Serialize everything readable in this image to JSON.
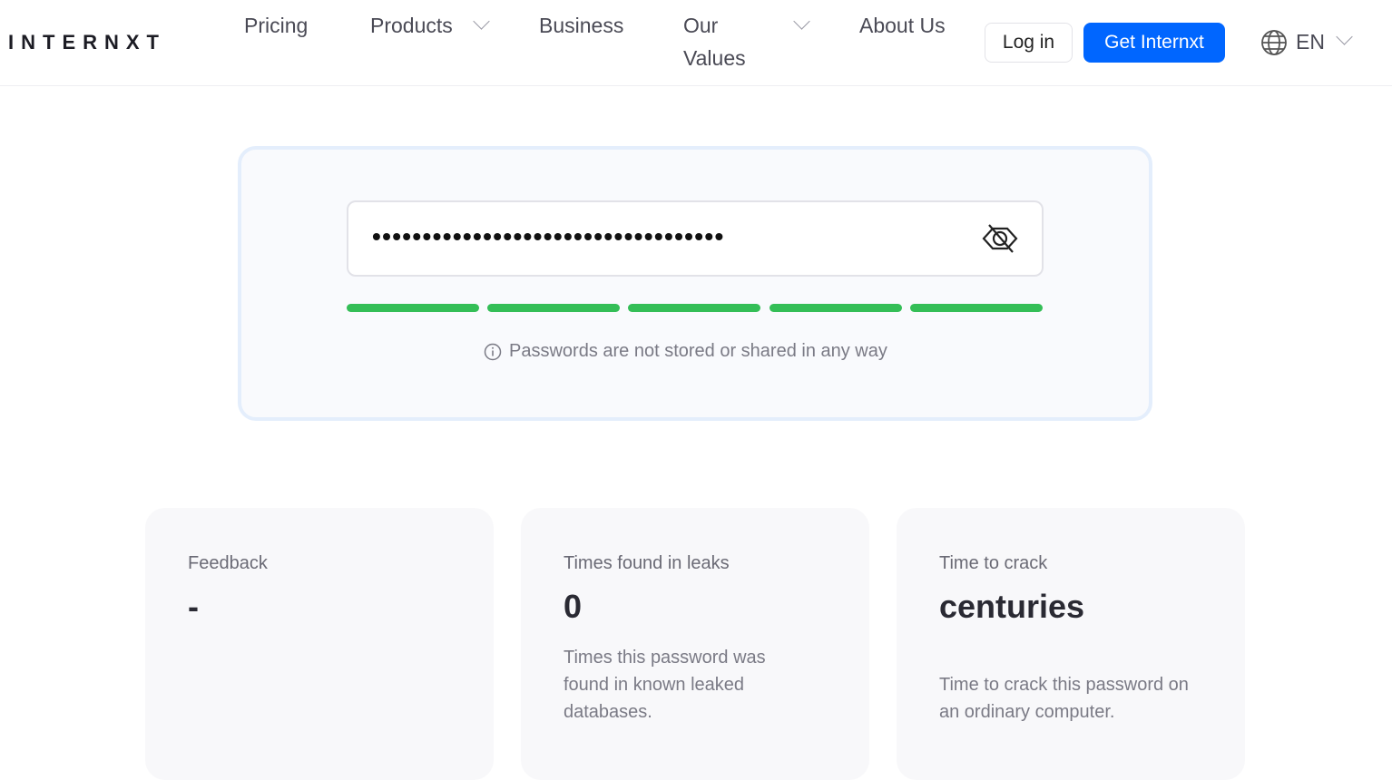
{
  "nav": {
    "logo": "INTERNXT",
    "pricing": "Pricing",
    "products": "Products",
    "business": "Business",
    "values_1": "Our",
    "values_2": "Values",
    "about": "About Us",
    "login": "Log in",
    "get": "Get Internxt",
    "lang": "EN"
  },
  "checker": {
    "password_mask": "•••••••••••••••••••••••••••••••••••",
    "strength_segments_filled": 5,
    "strength_segments_total": 5,
    "strength_color": "#34be57",
    "note": "Passwords are not stored or shared in any way"
  },
  "cards": [
    {
      "title": "Feedback",
      "value": "-",
      "desc": ""
    },
    {
      "title": "Times found in leaks",
      "value": "0",
      "desc": "Times this password was found in known leaked databases."
    },
    {
      "title": "Time to crack",
      "value": "centuries",
      "desc": "Time to crack this password on an ordinary computer."
    }
  ],
  "colors": {
    "accent": "#0066ff"
  }
}
